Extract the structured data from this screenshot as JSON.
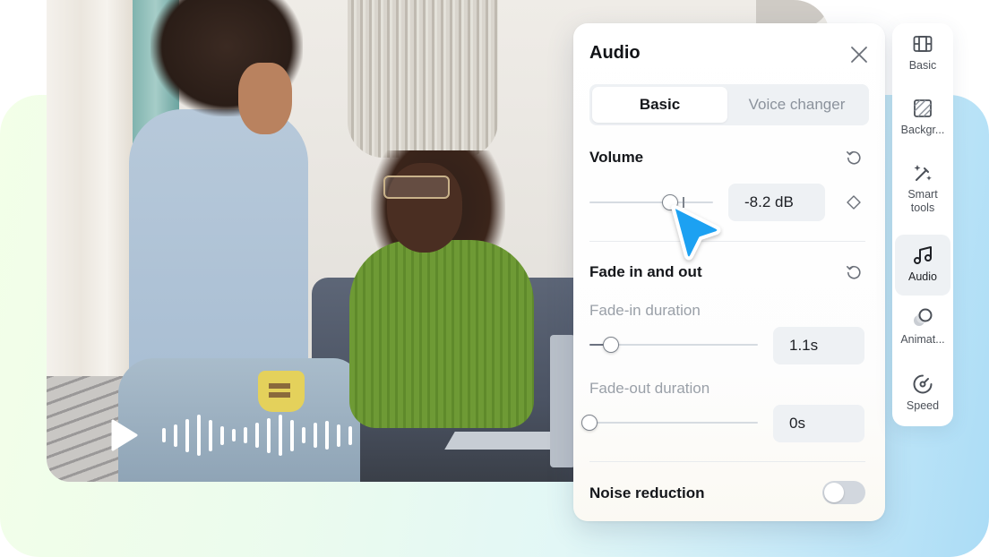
{
  "media_preview": {
    "play_icon": "play-icon",
    "waveform_bars": [
      0.35,
      0.55,
      0.8,
      1.0,
      0.75,
      0.45,
      0.3,
      0.4,
      0.6,
      0.85,
      1.0,
      0.75,
      0.4,
      0.6,
      0.7,
      0.55,
      0.45
    ]
  },
  "audio_panel": {
    "title": "Audio",
    "close_icon": "close-icon",
    "tabs": [
      {
        "label": "Basic",
        "active": true
      },
      {
        "label": "Voice changer",
        "active": false
      }
    ],
    "volume": {
      "label": "Volume",
      "reset_icon": "reset-icon",
      "slider_fraction": 0.65,
      "value": "-8.2 dB",
      "keyframe_icon": "keyframe-diamond-icon"
    },
    "fade": {
      "label": "Fade in and out",
      "reset_icon": "reset-icon",
      "fade_in": {
        "label": "Fade-in duration",
        "value": "1.1s",
        "slider_fraction": 0.13
      },
      "fade_out": {
        "label": "Fade-out duration",
        "value": "0s",
        "slider_fraction": 0.0
      }
    },
    "noise_reduction": {
      "label": "Noise reduction",
      "enabled": false
    }
  },
  "tool_rail": {
    "items": [
      {
        "label": "Basic",
        "icon": "film-icon",
        "active": false
      },
      {
        "label": "Backgr...",
        "icon": "background-icon",
        "active": false
      },
      {
        "label": "Smart tools",
        "icon": "magic-wand-icon",
        "active": false
      },
      {
        "label": "Audio",
        "icon": "music-note-icon",
        "active": true
      },
      {
        "label": "Animat...",
        "icon": "animation-icon",
        "active": false
      },
      {
        "label": "Speed",
        "icon": "speedometer-icon",
        "active": false
      }
    ]
  },
  "colors": {
    "accent_cursor": "#1ea1f2",
    "panel_bg": "#ffffff",
    "chip_bg": "#eef1f4",
    "bg_gradient_left": "#f3ffe8",
    "bg_gradient_right": "#abdcf6"
  }
}
